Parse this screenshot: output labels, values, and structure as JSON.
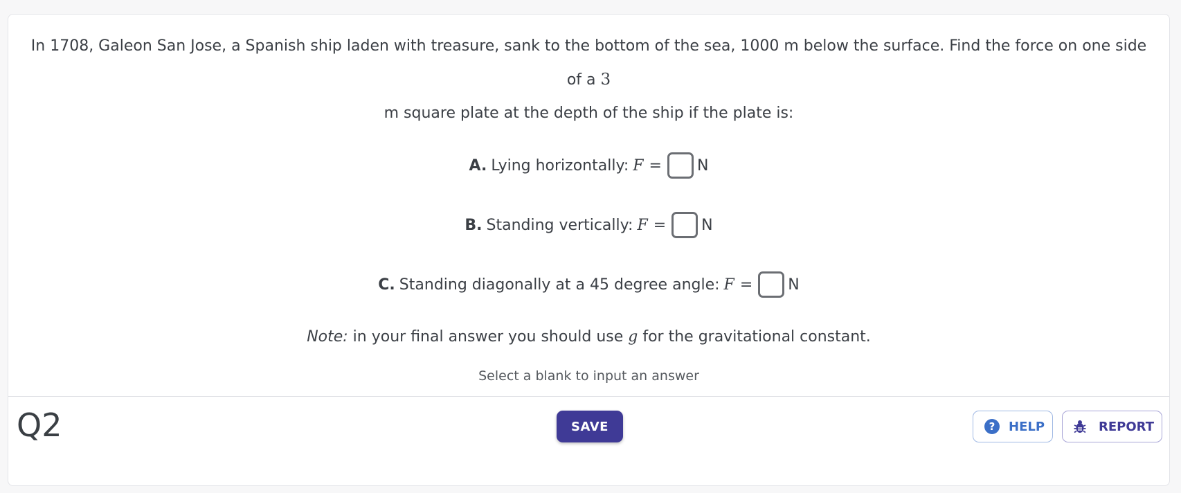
{
  "question": {
    "intro_text": "In 1708, Galeon San Jose, a Spanish ship laden with treasure, sank to the bottom of the sea, 1000 m below the surface. Find the force on one side of a ",
    "intro_number": "3",
    "intro_line2": "m square plate at the depth of the ship if the plate is:",
    "parts": [
      {
        "letter": "A.",
        "text": "Lying horizontally:",
        "var": "F",
        "equals": "=",
        "unit": "N"
      },
      {
        "letter": "B.",
        "text": "Standing vertically:",
        "var": "F",
        "equals": "=",
        "unit": "N"
      },
      {
        "letter": "C.",
        "text": "Standing diagonally at a 45 degree angle:",
        "var": "F",
        "equals": "=",
        "unit": "N"
      }
    ],
    "note_label": "Note:",
    "note_before": " in your final answer you should use ",
    "note_var": "g",
    "note_after": " for the gravitational constant."
  },
  "hint": "Select a blank to input an answer",
  "footer": {
    "question_label": "Q2",
    "save_label": "SAVE",
    "help_label": "HELP",
    "report_label": "REPORT",
    "help_icon": "question-circle-icon",
    "report_icon": "bug-icon"
  },
  "colors": {
    "save_bg": "#3f3a96",
    "help": "#3b6fc7",
    "report": "#3f3a96"
  }
}
